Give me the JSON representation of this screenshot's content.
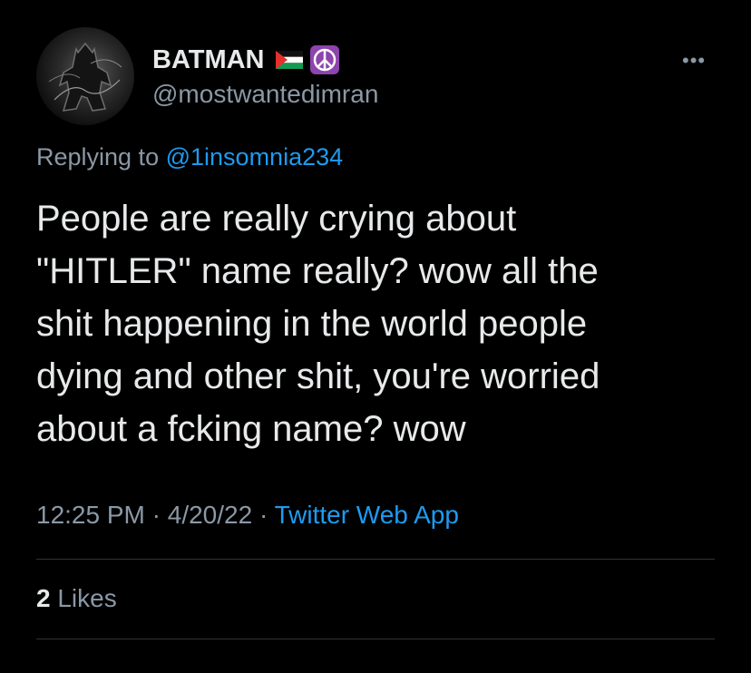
{
  "author": {
    "display_name": "BATMAN",
    "handle": "@mostwantedimran",
    "badges": [
      "palestine-flag-emoji",
      "peace-symbol-emoji"
    ]
  },
  "reply": {
    "prefix": "Replying to",
    "mention": "@1insomnia234"
  },
  "tweet": {
    "text": "People are really crying about\n\"HITLER\" name really? wow all the\nshit happening in the world people\ndying and other shit, you're worried\nabout a fcking name? wow"
  },
  "meta": {
    "time": "12:25 PM",
    "separator": "·",
    "date": "4/20/22",
    "source": "Twitter Web App"
  },
  "stats": {
    "likes_count": "2",
    "likes_label": "Likes"
  },
  "colors": {
    "background": "#000000",
    "primary_text": "#e7e9ea",
    "secondary_text": "#8b98a5",
    "link": "#1d9bf0",
    "divider": "#2f3336"
  }
}
